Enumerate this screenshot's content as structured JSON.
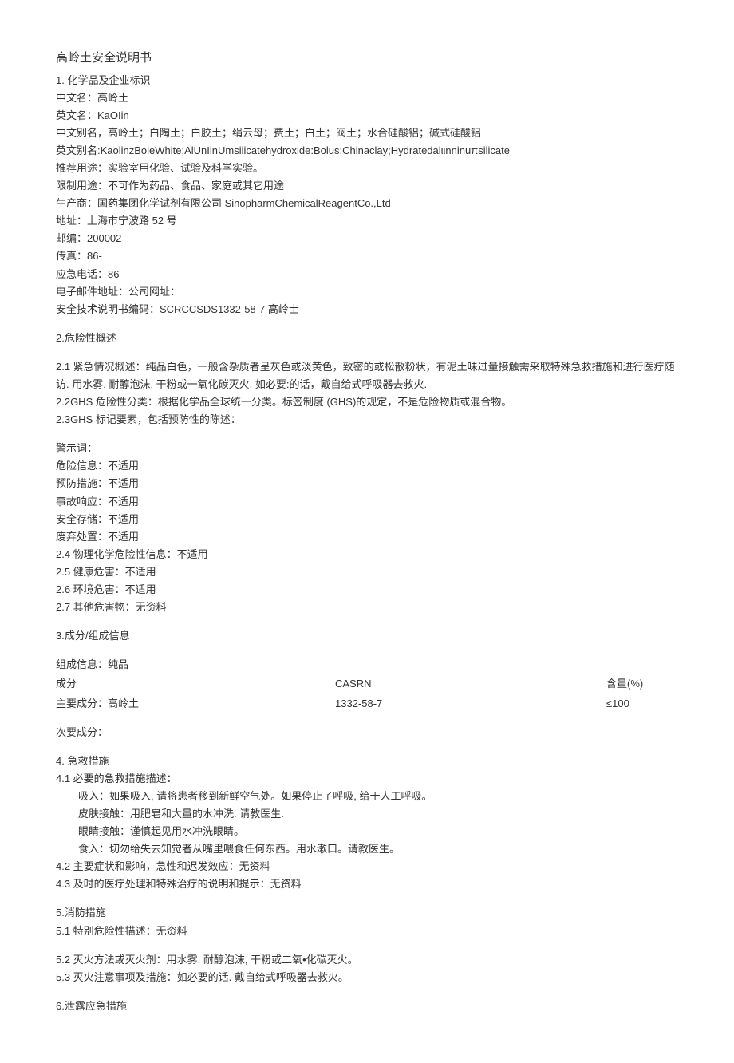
{
  "title": "高岭土安全说明书",
  "s1": {
    "h": "1. 化学品及企业标识",
    "cn_name": "中文名：高岭土",
    "en_name": "英文名：KaOIin",
    "cn_alias": "中文别名，高岭土；白陶土；白胶土；绢云母；费土；白土；阀土；水合硅酸铝；碱式硅酸铝",
    "en_alias": "英文别名:KaolinzBoleWhite;AlUnIinUmsilicatehydroxide:Bolus;Chinaclay;Hydratedalιιnninuπsilicate",
    "rec_use": "推荐用途：实验室用化验、试验及科学实验。",
    "lim_use": "限制用途：不可作为药品、食品、家庭或其它用途",
    "mfr": "生产商：国药集团化学试剂有限公司 SinopharmChemicalReagentCo.,Ltd",
    "addr": "地址：上海市宁波路 52 号",
    "post": "邮编：200002",
    "fax": "传真：86-",
    "tel": "应急电话：86-",
    "email": "电子邮件地址：公司网址：",
    "sds_code": "安全技术说明书编码：SCRCCSDS1332-58-7 高岭士"
  },
  "s2": {
    "h": "2.危险性概述",
    "p21": "2.1 紧急情况概述：纯品白色，一般含杂质者呈灰色或淡黄色，致密的或松散粉状，有泥土味过量接触需采取特殊急救措施和进行医疗随访. 用水雾, 耐醇泡沫, 干粉或一氧化碳灭火. 如必要:的话，戴自给式呼吸器去救火.",
    "p22": "2.2GHS 危险性分类：根据化学品全球统一分类。标签制度 (GHS)的规定，不是危险物质或混合物。",
    "p23": "2.3GHS 标记要素，包括预防性的陈述：",
    "warn": "警示词：",
    "haz": "危险信息：不适用",
    "prev": "预防措施：不适用",
    "acc": "事故响应：不适用",
    "store": "安全存储：不适用",
    "disp": "废弃处置：不适用",
    "p24": "2.4 物理化学危险性信息：不适用",
    "p25": "2.5 健康危害：不适用",
    "p26": "2.6 环境危害：不适用",
    "p27": "2.7 其他危害物：无资料"
  },
  "s3": {
    "h": "3.成分/组成信息",
    "info": "组成信息：纯品",
    "hdr_c": "成分",
    "hdr_cas": "CASRN",
    "hdr_pct": "含量(%)",
    "main_c": "主要成分：高岭土",
    "main_cas": "1332-58-7",
    "main_pct": "≤100",
    "minor": "次要成分："
  },
  "s4": {
    "h": "4. 急救措施",
    "p41": "4.1 必要的急救措施描述：",
    "inh": "吸入：如果吸入, 请将患者移到新鲜空气处。如果停止了呼吸, 给于人工呼吸。",
    "skin": "皮肤接触：用肥皂和大量的水冲洗. 请教医生.",
    "eye": "眼睛接触：谨慎起见用水冲洗眼睛。",
    "ing": "食入：切勿给失去知觉者从嘴里喂食任何东西。用水漱口。请教医生。",
    "p42": "4.2 主要症状和影响，急性和迟发效应：无资料",
    "p43": "4.3 及时的医疗处理和特殊治疗的说明和提示：无资料"
  },
  "s5": {
    "h": "5.消防措施",
    "p51": "5.1 特别危险性描述：无资料",
    "p52": "5.2 灭火方法或灭火剂：用水雾, 耐醇泡沫, 干粉或二氧•化碳灭火。",
    "p53": "5.3 灭火注意事项及措施：如必要的话. 戴自给式呼吸器去救火。"
  },
  "s6": {
    "h": "6.泄露应急措施"
  }
}
